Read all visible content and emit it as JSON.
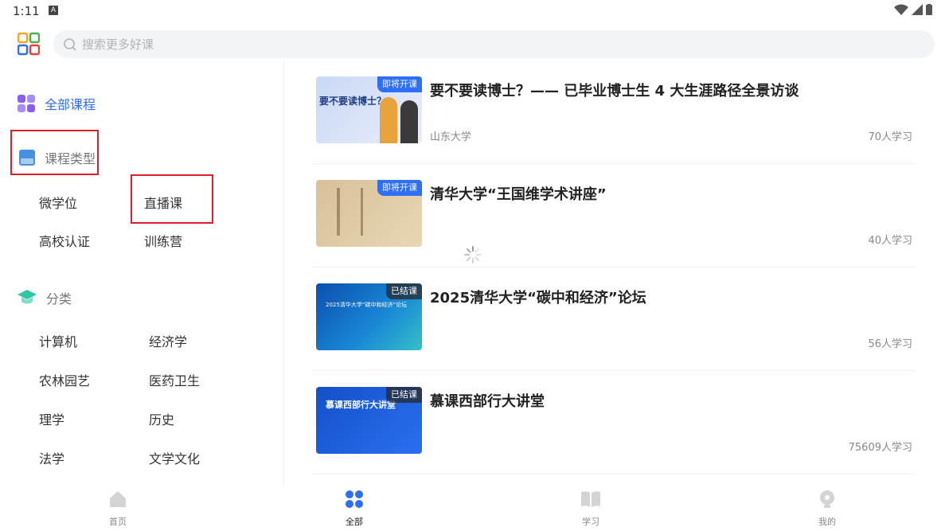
{
  "status": {
    "time": "1:11",
    "notif": "A"
  },
  "search": {
    "placeholder": "搜索更多好课"
  },
  "sidebar": {
    "all_courses": "全部课程",
    "course_type_header": "课程类型",
    "course_types": [
      "微学位",
      "直播课",
      "高校认证",
      "训练营"
    ],
    "category_header": "分类",
    "categories": [
      "计算机",
      "经济学",
      "农林园艺",
      "医药卫生",
      "理学",
      "历史",
      "法学",
      "文学文化"
    ]
  },
  "courses": [
    {
      "title": "要不要读博士？—— 已毕业博士生 4 大生涯路径全景访谈",
      "school": "山东大学",
      "learners": "70人学习",
      "badge": "即将开课",
      "thumb_text": "要不要读博士？"
    },
    {
      "title": "清华大学“王国维学术讲座”",
      "school": "",
      "learners": "40人学习",
      "badge": "即将开课",
      "thumb_text": ""
    },
    {
      "title": "2025清华大学“碳中和经济”论坛",
      "school": "",
      "learners": "56人学习",
      "badge": "已结课",
      "thumb_text": "2025清华大学“碳中和经济”论坛"
    },
    {
      "title": "慕课西部行大讲堂",
      "school": "",
      "learners": "75609人学习",
      "badge": "已结课",
      "thumb_text": "慕课西部行大讲堂"
    }
  ],
  "nav": [
    {
      "label": "首页",
      "icon": "home-icon"
    },
    {
      "label": "全部",
      "icon": "grid-icon"
    },
    {
      "label": "学习",
      "icon": "book-icon"
    },
    {
      "label": "我的",
      "icon": "profile-icon"
    }
  ],
  "colors": {
    "accent": "#2f6ef6",
    "highlight_box": "#d9202a"
  }
}
